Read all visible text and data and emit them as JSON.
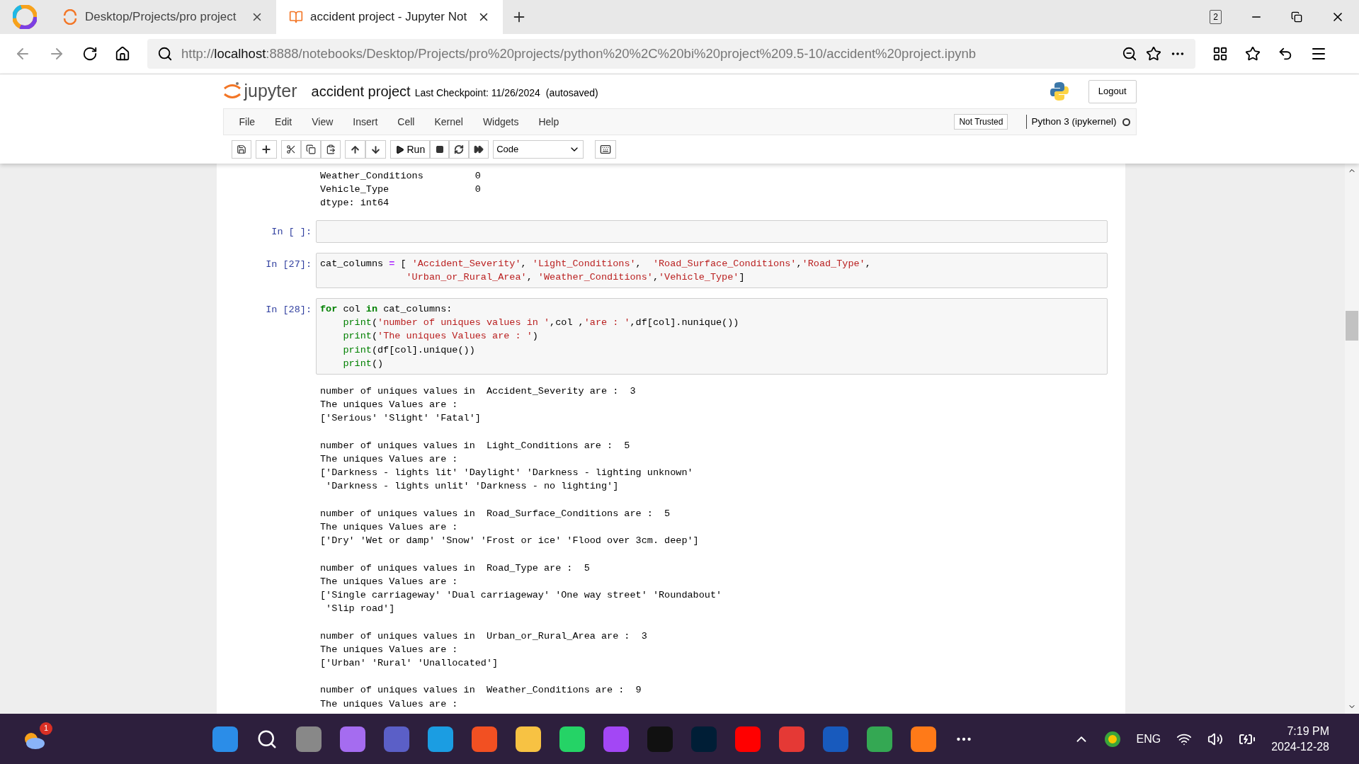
{
  "browser": {
    "tabs": [
      {
        "title": "Desktop/Projects/pro project",
        "selected": false
      },
      {
        "title": "accident project - Jupyter Not",
        "selected": true
      }
    ],
    "tab_count": "2",
    "url": {
      "scheme": "http://",
      "host": "localhost",
      "path": ":8888/notebooks/Desktop/Projects/pro%20projects/python%20%2C%20bi%20project%209.5-10/accident%20project.ipynb"
    }
  },
  "jupyter": {
    "logo_text": "jupyter",
    "notebook_name": "accident project",
    "checkpoint": "Last Checkpoint: 11/26/2024",
    "autosave": "(autosaved)",
    "logout": "Logout",
    "menu": [
      "File",
      "Edit",
      "View",
      "Insert",
      "Cell",
      "Kernel",
      "Widgets",
      "Help"
    ],
    "trust": "Not Trusted",
    "kernel": "Python 3 (ipykernel)",
    "kernel_busy": false,
    "run_label": "Run",
    "cell_type": "Code"
  },
  "cells": [
    {
      "kind": "output",
      "blocks": [
        [
          "Weather_Conditions         0",
          "Vehicle_Type               0",
          "dtype: int64"
        ]
      ]
    },
    {
      "kind": "code",
      "prompt": "In [ ]:"
    },
    {
      "kind": "code",
      "prompt": "In [27]:",
      "lines": [
        [
          {
            "kind": "plain",
            "text": "cat_columns "
          },
          {
            "kind": "op",
            "text": "="
          },
          {
            "kind": "plain",
            "text": " [ "
          },
          {
            "kind": "str",
            "text": "'Accident_Severity'"
          },
          {
            "kind": "plain",
            "text": ", "
          },
          {
            "kind": "str",
            "text": "'Light_Conditions'"
          },
          {
            "kind": "plain",
            "text": ",  "
          },
          {
            "kind": "str",
            "text": "'Road_Surface_Conditions'"
          },
          {
            "kind": "plain",
            "text": ","
          },
          {
            "kind": "str",
            "text": "'Road_Type'"
          },
          {
            "kind": "plain",
            "text": ","
          }
        ],
        [
          {
            "kind": "str",
            "text": "               'Urban_or_Rural_Area'"
          },
          {
            "kind": "plain",
            "text": ", "
          },
          {
            "kind": "str",
            "text": "'Weather_Conditions'"
          },
          {
            "kind": "plain",
            "text": ","
          },
          {
            "kind": "str",
            "text": "'Vehicle_Type'"
          },
          {
            "kind": "plain",
            "text": "]"
          }
        ]
      ]
    },
    {
      "kind": "code",
      "prompt": "In [28]:",
      "lines": [
        [
          {
            "kind": "kw",
            "text": "for"
          },
          {
            "kind": "plain",
            "text": " col "
          },
          {
            "kind": "kw",
            "text": "in"
          },
          {
            "kind": "plain",
            "text": " cat_columns:"
          }
        ],
        [
          {
            "kind": "builtin",
            "text": "    print"
          },
          {
            "kind": "plain",
            "text": "("
          },
          {
            "kind": "str",
            "text": "'number of uniques values in '"
          },
          {
            "kind": "plain",
            "text": ",col ,"
          },
          {
            "kind": "str",
            "text": "'are : '"
          },
          {
            "kind": "plain",
            "text": ",df[col].nunique())"
          }
        ],
        [
          {
            "kind": "builtin",
            "text": "    print"
          },
          {
            "kind": "plain",
            "text": "("
          },
          {
            "kind": "str",
            "text": "'The uniques Values are : '"
          },
          {
            "kind": "plain",
            "text": ")"
          }
        ],
        [
          {
            "kind": "builtin",
            "text": "    print"
          },
          {
            "kind": "plain",
            "text": "(df[col].unique())"
          }
        ],
        [
          {
            "kind": "builtin",
            "text": "    print"
          },
          {
            "kind": "plain",
            "text": "()"
          }
        ]
      ]
    },
    {
      "kind": "output",
      "blocks": [
        [
          "number of uniques values in  Accident_Severity are :  3",
          "The uniques Values are : ",
          "['Serious' 'Slight' 'Fatal']"
        ],
        [
          "number of uniques values in  Light_Conditions are :  5",
          "The uniques Values are : ",
          "['Darkness - lights lit' 'Daylight' 'Darkness - lighting unknown'",
          " 'Darkness - lights unlit' 'Darkness - no lighting']"
        ],
        [
          "number of uniques values in  Road_Surface_Conditions are :  5",
          "The uniques Values are : ",
          "['Dry' 'Wet or damp' 'Snow' 'Frost or ice' 'Flood over 3cm. deep']"
        ],
        [
          "number of uniques values in  Road_Type are :  5",
          "The uniques Values are : ",
          "['Single carriageway' 'Dual carriageway' 'One way street' 'Roundabout'",
          " 'Slip road']"
        ],
        [
          "number of uniques values in  Urban_or_Rural_Area are :  3",
          "The uniques Values are : ",
          "['Urban' 'Rural' 'Unallocated']"
        ],
        [
          "number of uniques values in  Weather_Conditions are :  9",
          "The uniques Values are : "
        ]
      ]
    }
  ],
  "taskbar": {
    "weather_badge": "1",
    "language": "ENG",
    "time": "7:19 PM",
    "date": "2024-12-28"
  }
}
